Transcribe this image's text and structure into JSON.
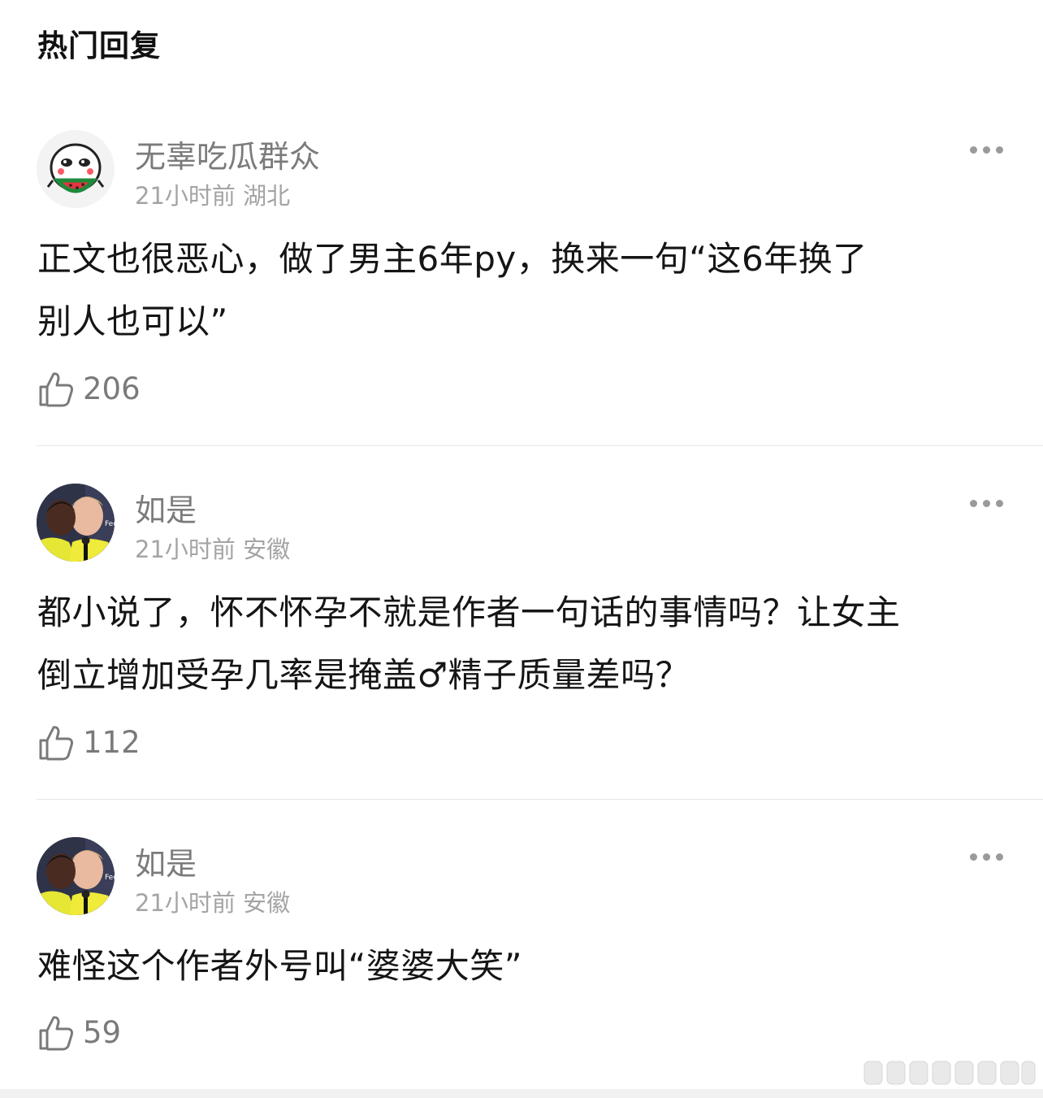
{
  "section_title": "热门回复",
  "comments": [
    {
      "username": "无辜吃瓜群众",
      "time": "21小时前",
      "location": "湖北",
      "text_line1": "正文也很恶心，做了男主6年py，换来一句“这6年换了",
      "text_line2": "别人也可以”",
      "likes": "206",
      "avatar": "watermelon-emoji-avatar"
    },
    {
      "username": "如是",
      "time": "21小时前",
      "location": "安徽",
      "text_line1": "都小说了，怀不怀孕不就是作者一句话的事情吗？让女主",
      "text_line2": "倒立增加受孕几率是掩盖♂精子质量差吗？",
      "likes": "112",
      "avatar": "football-players-avatar"
    },
    {
      "username": "如是",
      "time": "21小时前",
      "location": "安徽",
      "text_line1": "难怪这个作者外号叫“婆婆大笑”",
      "likes": "59",
      "avatar": "football-players-avatar"
    }
  ],
  "icons": {
    "like": "thumbs-up-icon",
    "more": "more-dots-icon"
  },
  "colors": {
    "username": "#7b7b7b",
    "meta": "#a4a4a4",
    "body_text": "#151515",
    "like_count": "#7a7a7a",
    "divider": "#e6e6e6"
  }
}
